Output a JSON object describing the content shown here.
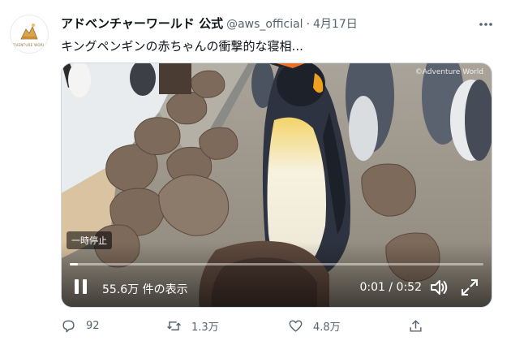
{
  "tweet": {
    "avatar_text": "ADVENTURE WORLD",
    "display_name": "アドベンチャーワールド 公式",
    "handle": "@aws_official",
    "separator": "·",
    "date": "4月17日",
    "text": "キングペンギンの赤ちゃんの衝撃的な寝相..."
  },
  "video": {
    "watermark": "©Adventure World",
    "paused_label": "一時停止",
    "views": "55.6万 件の表示",
    "time": "0:01 / 0:52",
    "progress": 0.02
  },
  "actions": {
    "replies": "92",
    "retweets": "1.3万",
    "likes": "4.8万"
  },
  "colors": {
    "text_primary": "#0f1419",
    "text_secondary": "#536471",
    "border": "#cfd9de"
  },
  "icons": [
    "avatar-logo-icon",
    "more-icon",
    "pause-icon",
    "volume-icon",
    "fullscreen-icon",
    "reply-icon",
    "retweet-icon",
    "like-icon",
    "share-icon"
  ]
}
